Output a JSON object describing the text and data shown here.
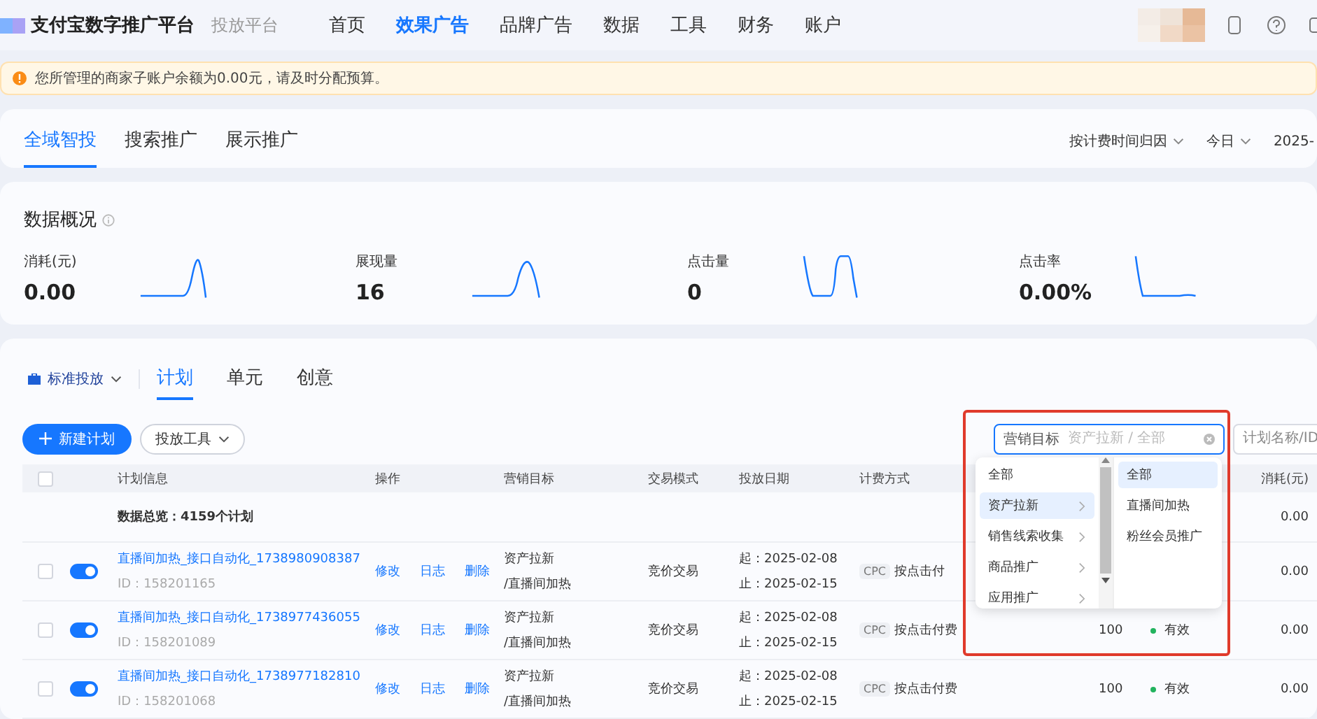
{
  "header": {
    "brand": "支付宝数字推广平台",
    "subtitle": "投放平台",
    "nav": [
      {
        "label": "首页",
        "selected": false
      },
      {
        "label": "效果广告",
        "selected": true
      },
      {
        "label": "品牌广告",
        "selected": false
      },
      {
        "label": "数据",
        "selected": false
      },
      {
        "label": "工具",
        "selected": false
      },
      {
        "label": "财务",
        "selected": false
      },
      {
        "label": "账户",
        "selected": false
      }
    ]
  },
  "alert": {
    "message": "您所管理的商家子账户余额为0.00元，请及时分配预算。"
  },
  "channel_tabs": {
    "tabs": [
      {
        "label": "全域智投",
        "selected": true
      },
      {
        "label": "搜索推广",
        "selected": false
      },
      {
        "label": "展示推广",
        "selected": false
      }
    ],
    "attribution": "按计费时间归因",
    "period": "今日",
    "date": "2025-"
  },
  "overview": {
    "title": "数据概况",
    "metrics": [
      {
        "label": "消耗(元)",
        "value": "0.00"
      },
      {
        "label": "展现量",
        "value": "16"
      },
      {
        "label": "点击量",
        "value": "0"
      },
      {
        "label": "点击率",
        "value": "0.00%"
      }
    ]
  },
  "plans": {
    "mode": "标准投放",
    "tabs": [
      {
        "label": "计划",
        "selected": true
      },
      {
        "label": "单元",
        "selected": false
      },
      {
        "label": "创意",
        "selected": false
      }
    ],
    "new_button": "新建计划",
    "tools_button": "投放工具",
    "goal_filter": {
      "label": "营销目标",
      "placeholder": "资产拉新 / 全部"
    },
    "name_search": {
      "placeholder": "计划名称/ID"
    },
    "select_all_checked": false,
    "columns": [
      "计划信息",
      "操作",
      "营销目标",
      "交易模式",
      "投放日期",
      "计费方式",
      "消耗(元)"
    ],
    "summary": {
      "text": "数据总览：4159个计划",
      "cost": "0.00"
    },
    "rows": [
      {
        "name": "直播间加热_接口自动化_1738980908387",
        "id": "ID：158201165",
        "checked": false,
        "on": true,
        "actions": [
          "修改",
          "日志",
          "删除"
        ],
        "goal": [
          "资产拉新",
          "/直播间加热"
        ],
        "mode": "竞价交易",
        "start": "起：2025-02-08",
        "end": "止：2025-02-15",
        "billing_tag": "CPC",
        "billing": "按点击付",
        "cost": "0.00"
      },
      {
        "name": "直播间加热_接口自动化_1738977436055",
        "id": "ID：158201089",
        "checked": false,
        "on": true,
        "actions": [
          "修改",
          "日志",
          "删除"
        ],
        "goal": [
          "资产拉新",
          "/直播间加热"
        ],
        "mode": "竞价交易",
        "start": "起：2025-02-08",
        "end": "止：2025-02-15",
        "billing_tag": "CPC",
        "billing": "按点击付费",
        "bid": "100",
        "status": "有效",
        "cost": "0.00"
      },
      {
        "name": "直播间加热_接口自动化_1738977182810",
        "id": "ID：158201068",
        "checked": false,
        "on": true,
        "actions": [
          "修改",
          "日志",
          "删除"
        ],
        "goal": [
          "资产拉新",
          "/直播间加热"
        ],
        "mode": "竞价交易",
        "start": "起：2025-02-08",
        "end": "止：2025-02-15",
        "billing_tag": "CPC",
        "billing": "按点击付费",
        "bid": "100",
        "status": "有效",
        "cost": "0.00"
      }
    ],
    "cascader": {
      "level_1": [
        {
          "label": "全部",
          "selected": false,
          "has_children": false
        },
        {
          "label": "资产拉新",
          "selected": true,
          "has_children": true
        },
        {
          "label": "销售线索收集",
          "selected": false,
          "has_children": true
        },
        {
          "label": "商品推广",
          "selected": false,
          "has_children": true
        },
        {
          "label": "应用推广",
          "selected": false,
          "has_children": true
        }
      ],
      "level_2": [
        {
          "label": "全部",
          "selected": true
        },
        {
          "label": "直播间加热",
          "selected": false
        },
        {
          "label": "粉丝会员推广",
          "selected": false
        }
      ]
    }
  }
}
